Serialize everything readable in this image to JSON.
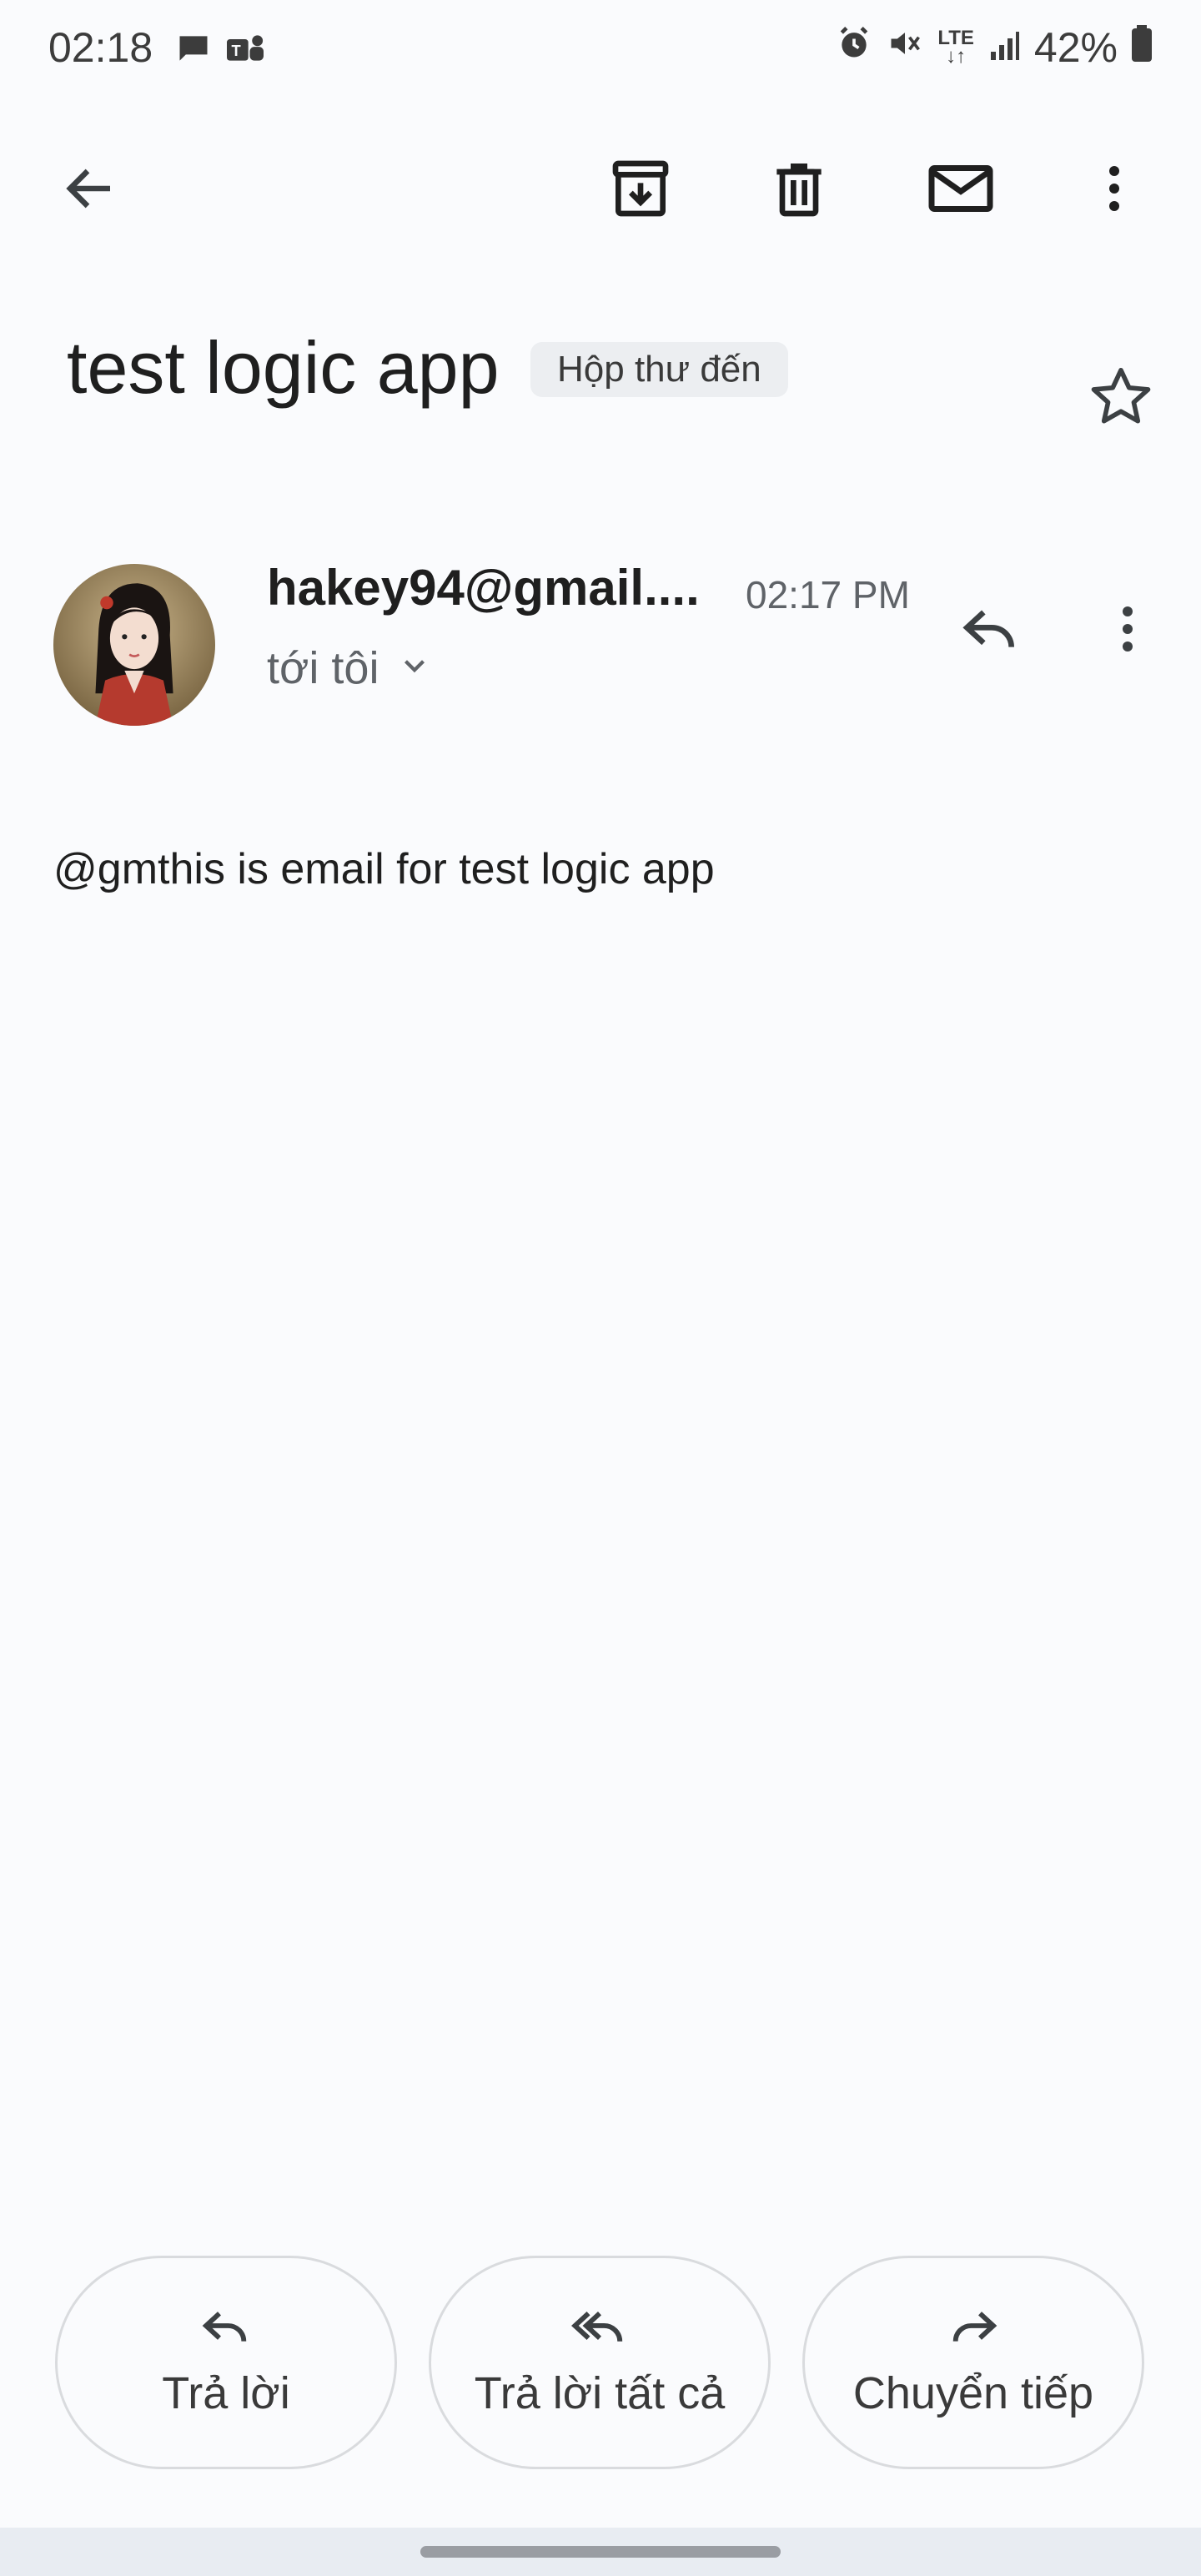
{
  "status_bar": {
    "time": "02:18",
    "battery": "42%",
    "network": "LTE"
  },
  "toolbar": {
    "back_icon": "arrow-back-icon",
    "archive_icon": "archive-icon",
    "delete_icon": "delete-icon",
    "mark_unread_icon": "mail-icon",
    "more_icon": "more-vert-icon"
  },
  "email": {
    "subject": "test logic app",
    "label": "Hộp thư đến",
    "sender": "hakey94@gmail....",
    "time": "02:17 PM",
    "recipient": "tới tôi",
    "body": "@gmthis is email for test logic app"
  },
  "actions": {
    "reply": "Trả lời",
    "reply_all": "Trả lời tất cả",
    "forward": "Chuyển tiếp"
  },
  "colors": {
    "background": "#fafbfd",
    "chip": "#eceef1",
    "icon": "#3c4043"
  }
}
